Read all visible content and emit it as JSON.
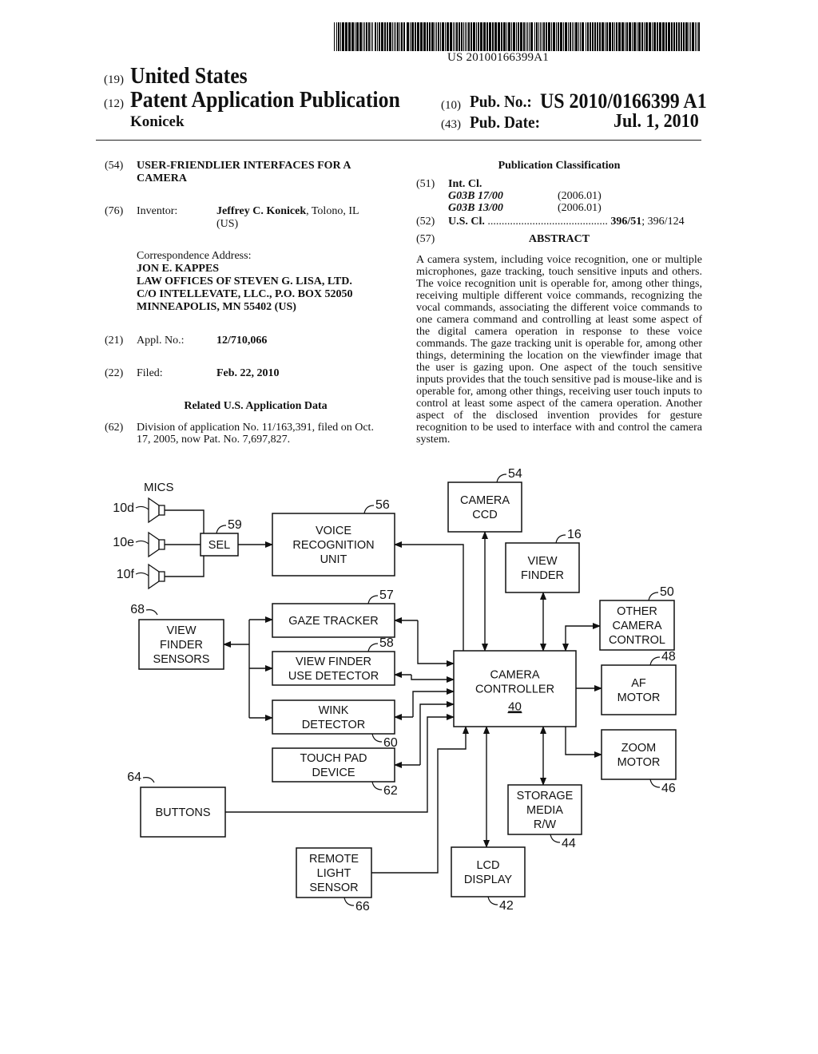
{
  "header": {
    "barcode_number": "US 20100166399A1",
    "country_code": "(19)",
    "country": "United States",
    "type_code": "(12)",
    "type": "Patent Application Publication",
    "inventor_surname": "Konicek",
    "pub_no_code": "(10)",
    "pub_no_label": "Pub. No.:",
    "pub_no": "US 2010/0166399 A1",
    "pub_date_code": "(43)",
    "pub_date_label": "Pub. Date:",
    "pub_date": "Jul. 1, 2010"
  },
  "left": {
    "title_code": "(54)",
    "title_line1": "USER-FRIENDLIER INTERFACES FOR A",
    "title_line2": "CAMERA",
    "inventor_code": "(76)",
    "inventor_label": "Inventor:",
    "inventor_name": "Jeffrey C. Konicek",
    "inventor_loc": ", Tolono, IL",
    "inventor_country": "(US)",
    "corr_label": "Correspondence Address:",
    "corr_lines": [
      "JON E. KAPPES",
      "LAW OFFICES OF STEVEN G. LISA, LTD.",
      "C/O INTELLEVATE, LLC., P.O. BOX 52050",
      "MINNEAPOLIS, MN 55402 (US)"
    ],
    "appl_code": "(21)",
    "appl_label": "Appl. No.:",
    "appl_no": "12/710,066",
    "filed_code": "(22)",
    "filed_label": "Filed:",
    "filed_date": "Feb. 22, 2010",
    "related_heading": "Related U.S. Application Data",
    "division_code": "(62)",
    "division_line1": "Division of application No. 11/163,391, filed on Oct.",
    "division_line2": "17, 2005, now Pat. No. 7,697,827."
  },
  "right": {
    "classification_heading": "Publication Classification",
    "intcl_code": "(51)",
    "intcl_label": "Int. Cl.",
    "intcl": [
      {
        "cls": "G03B 17/00",
        "ver": "(2006.01)"
      },
      {
        "cls": "G03B 13/00",
        "ver": "(2006.01)"
      }
    ],
    "uscl_code": "(52)",
    "uscl_label": "U.S. Cl.",
    "uscl_dots": "...........................................",
    "uscl_primary": "396/51",
    "uscl_secondary": "; 396/124",
    "abstract_code": "(57)",
    "abstract_heading": "ABSTRACT",
    "abstract_text": "A camera system, including voice recognition, one or multiple microphones, gaze tracking, touch sensitive inputs and others. The voice recognition unit is operable for, among other things, receiving multiple different voice commands, recognizing the vocal commands, associating the different voice commands to one camera command and controlling at least some aspect of the digital camera operation in response to these voice commands. The gaze tracking unit is operable for, among other things, determining the location on the viewfinder image that the user is gazing upon. One aspect of the touch sensitive inputs provides that the touch sensitive pad is mouse-like and is operable for, among other things, receiving user touch inputs to control at least some aspect of the camera operation. Another aspect of the disclosed invention provides for gesture recognition to be used to interface with and control the camera system."
  },
  "diagram": {
    "mics_label": "MICS",
    "mic_refs": [
      "10d",
      "10e",
      "10f"
    ],
    "blocks": {
      "sel": {
        "lines": [
          "SEL"
        ],
        "ref": "59"
      },
      "voice": {
        "lines": [
          "VOICE",
          "RECOGNITION",
          "UNIT"
        ],
        "ref": "56"
      },
      "ccd": {
        "lines": [
          "CAMERA",
          "CCD"
        ],
        "ref": "54"
      },
      "viewfinder": {
        "lines": [
          "VIEW",
          "FINDER"
        ],
        "ref": "16"
      },
      "other": {
        "lines": [
          "OTHER",
          "CAMERA",
          "CONTROL"
        ],
        "ref": "50"
      },
      "vfsensors": {
        "lines": [
          "VIEW",
          "FINDER",
          "SENSORS"
        ],
        "ref": "68"
      },
      "gaze": {
        "lines": [
          "GAZE TRACKER"
        ],
        "ref": "57"
      },
      "vfuse": {
        "lines": [
          "VIEW FINDER",
          "USE DETECTOR"
        ],
        "ref": "58"
      },
      "wink": {
        "lines": [
          "WINK",
          "DETECTOR"
        ],
        "ref": "60"
      },
      "touch": {
        "lines": [
          "TOUCH PAD",
          "DEVICE"
        ],
        "ref": "62"
      },
      "controller": {
        "lines": [
          "CAMERA",
          "CONTROLLER"
        ],
        "ref_inside": "40"
      },
      "af": {
        "lines": [
          "AF",
          "MOTOR"
        ],
        "ref": "48"
      },
      "zoom": {
        "lines": [
          "ZOOM",
          "MOTOR"
        ],
        "ref": "46"
      },
      "buttons": {
        "lines": [
          "BUTTONS"
        ],
        "ref": "64"
      },
      "storage": {
        "lines": [
          "STORAGE",
          "MEDIA",
          "R/W"
        ],
        "ref": "44"
      },
      "remote": {
        "lines": [
          "REMOTE",
          "LIGHT",
          "SENSOR"
        ],
        "ref": "66"
      },
      "lcd": {
        "lines": [
          "LCD",
          "DISPLAY"
        ],
        "ref": "42"
      }
    }
  }
}
